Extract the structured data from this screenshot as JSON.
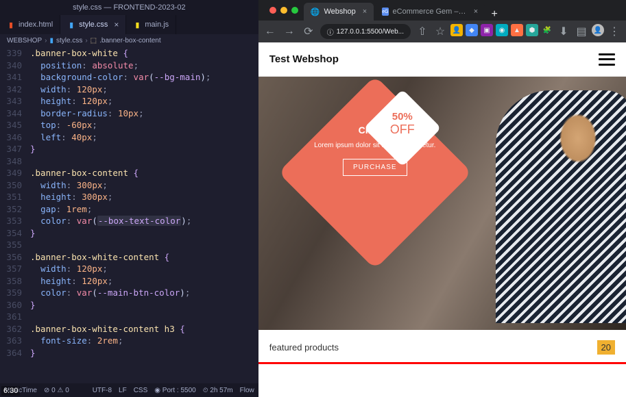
{
  "vscode": {
    "title": "style.css — FRONTEND-2023-02",
    "tabs": [
      {
        "icon": "html",
        "label": "index.html",
        "active": false
      },
      {
        "icon": "css",
        "label": "style.css",
        "active": true
      },
      {
        "icon": "js",
        "label": "main.js",
        "active": false
      }
    ],
    "breadcrumb": [
      "WEBSHOP",
      "style.css",
      ".banner-box-content"
    ],
    "code_lines": [
      {
        "n": 339,
        "t": ".banner-box-white {",
        "cls": "sel"
      },
      {
        "n": 340,
        "t": "  position: absolute;",
        "cls": "prop"
      },
      {
        "n": 341,
        "t": "  background-color: var(--bg-main);",
        "cls": "prop"
      },
      {
        "n": 342,
        "t": "  width: 120px;",
        "cls": "prop"
      },
      {
        "n": 343,
        "t": "  height: 120px;",
        "cls": "prop"
      },
      {
        "n": 344,
        "t": "  border-radius: 10px;",
        "cls": "prop"
      },
      {
        "n": 345,
        "t": "  top: -60px;",
        "cls": "prop"
      },
      {
        "n": 346,
        "t": "  left: 40px;",
        "cls": "prop"
      },
      {
        "n": 347,
        "t": "}",
        "cls": "brace"
      },
      {
        "n": 348,
        "t": "",
        "cls": ""
      },
      {
        "n": 349,
        "t": ".banner-box-content {",
        "cls": "sel"
      },
      {
        "n": 350,
        "t": "  width: 300px;",
        "cls": "prop"
      },
      {
        "n": 351,
        "t": "  height: 300px;",
        "cls": "prop"
      },
      {
        "n": 352,
        "t": "  gap: 1rem;",
        "cls": "prop"
      },
      {
        "n": 353,
        "t": "  color: var(--box-text-color);",
        "cls": "prop hl"
      },
      {
        "n": 354,
        "t": "}",
        "cls": "brace"
      },
      {
        "n": 355,
        "t": "",
        "cls": ""
      },
      {
        "n": 356,
        "t": ".banner-box-white-content {",
        "cls": "sel"
      },
      {
        "n": 357,
        "t": "  width: 120px;",
        "cls": "prop"
      },
      {
        "n": 358,
        "t": "  height: 120px;",
        "cls": "prop"
      },
      {
        "n": 359,
        "t": "  color: var(--main-btn-color);",
        "cls": "prop"
      },
      {
        "n": 360,
        "t": "}",
        "cls": "brace"
      },
      {
        "n": 361,
        "t": "",
        "cls": ""
      },
      {
        "n": 362,
        "t": ".banner-box-white-content h3 {",
        "cls": "sel"
      },
      {
        "n": 363,
        "t": "  font-size: 2rem;",
        "cls": "prop"
      },
      {
        "n": 364,
        "t": "}",
        "cls": "brace"
      }
    ],
    "statusbar": {
      "left": [
        "MusicTime",
        "⊘ 0 ⚠ 0"
      ],
      "right": [
        "UTF-8",
        "LF",
        "CSS",
        "◉ Port : 5500",
        "⏲ 2h 57m",
        "Flow"
      ]
    }
  },
  "browser": {
    "tabs": [
      {
        "icon": "🛒",
        "label": "Webshop",
        "active": true,
        "closeable": true
      },
      {
        "icon": "eG",
        "label": "eCommerce Gem – Multipurpo",
        "active": false,
        "closeable": true
      }
    ],
    "newtab": "+",
    "nav": {
      "back": "←",
      "forward": "→",
      "reload": "⟳"
    },
    "address": "127.0.0.1:5500/Web...",
    "page": {
      "header_title": "Test Webshop",
      "banner": {
        "title": "Cimsor",
        "text": "Lorem ipsum dolor sit amet consectetur.",
        "button": "PURCHASE",
        "badge_pct": "50%",
        "badge_off": "OFF"
      },
      "featured_label": "featured products",
      "year": "20"
    }
  },
  "video_time": "6:30"
}
